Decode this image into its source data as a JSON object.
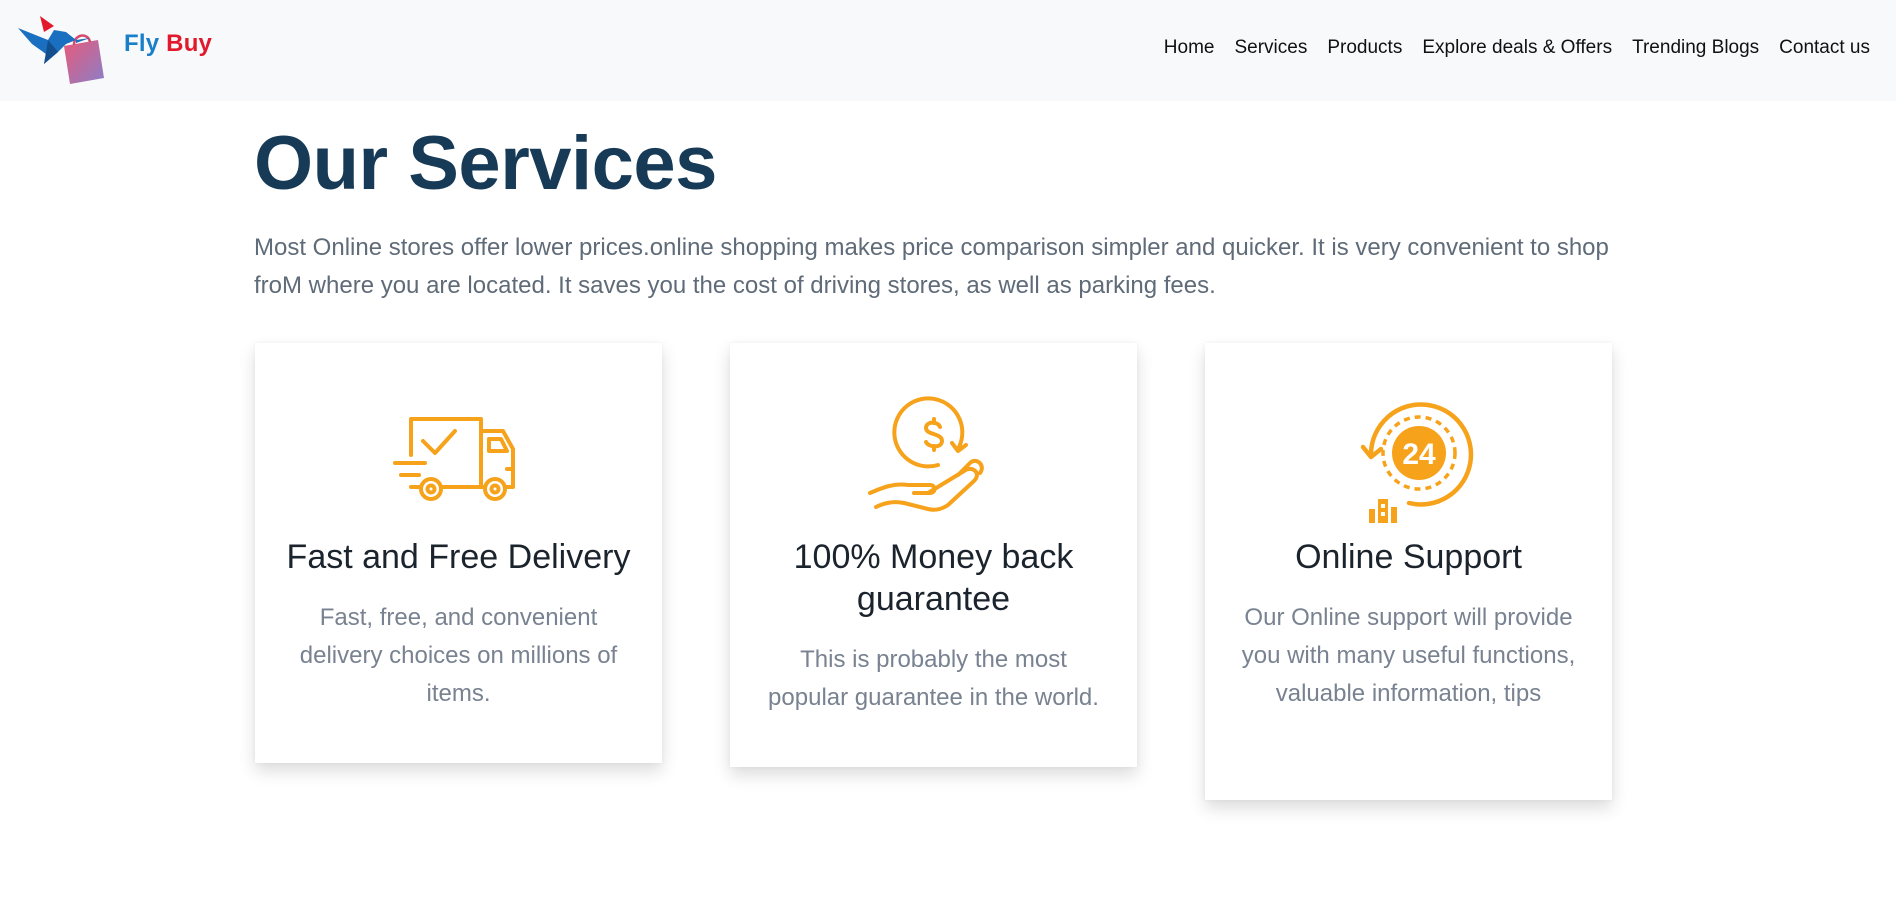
{
  "brand": {
    "name_part1": "Fly",
    "name_part2": "Buy",
    "color_part1": "#1a7fc9",
    "color_part2": "#e2192c",
    "logo_icon": "hummingbird-shopping-bag-logo"
  },
  "nav": {
    "items": [
      {
        "label": "Home"
      },
      {
        "label": "Services"
      },
      {
        "label": "Products"
      },
      {
        "label": "Explore deals & Offers"
      },
      {
        "label": "Trending Blogs"
      },
      {
        "label": "Contact us"
      }
    ]
  },
  "section": {
    "title": "Our Services",
    "description": "Most Online stores offer lower prices.online shopping makes price comparison simpler and quicker. It is very convenient to shop froM where you are located. It saves you the cost of driving stores, as well as parking fees."
  },
  "services": [
    {
      "icon": "delivery-truck-icon",
      "title": "Fast and Free Delivery",
      "text": "Fast, free, and convenient delivery choices on millions of items."
    },
    {
      "icon": "money-back-hand-icon",
      "title": "100% Money back guarantee",
      "text": "This is probably the most popular guarantee in the world."
    },
    {
      "icon": "support-24-hours-icon",
      "title": "Online Support",
      "text": "Our Online support will provide you with many useful functions, valuable information, tips"
    }
  ],
  "colors": {
    "accent": "#f7a21b",
    "title": "#173a57",
    "navbar_bg": "#f8f9fa",
    "body_text": "#5f6b78"
  }
}
